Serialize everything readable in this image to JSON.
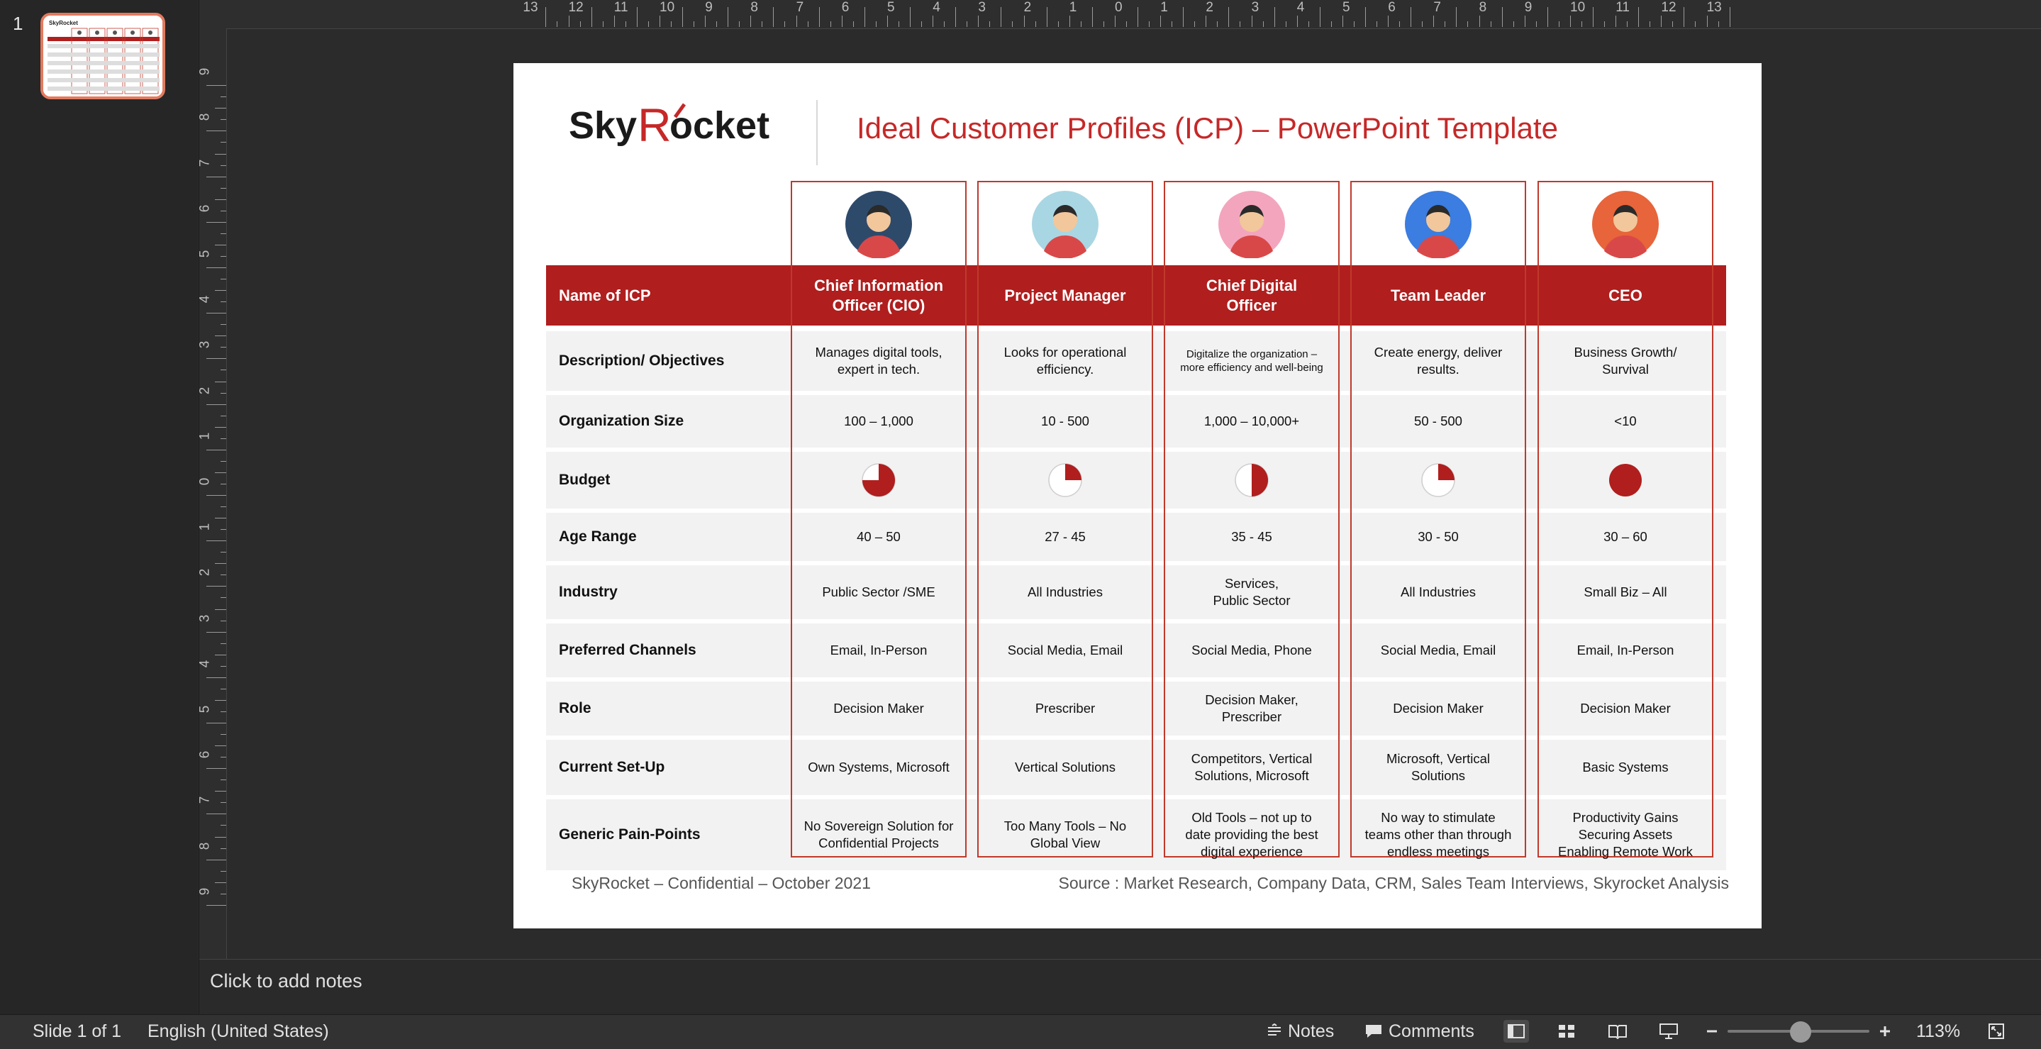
{
  "thumbnails": {
    "slide_number": "1"
  },
  "slide": {
    "logo_text": "SkyRocket",
    "title": "Ideal Customer Profiles (ICP) – PowerPoint Template",
    "header_label": "Name of ICP",
    "footer_left": "SkyRocket – Confidential – October 2021",
    "footer_right": "Source : Market Research, Company Data, CRM, Sales Team Interviews, Skyrocket Analysis",
    "row_labels": [
      "Description/ Objectives",
      "Organization Size",
      "Budget",
      "Age Range",
      "Industry",
      "Preferred Channels",
      "Role",
      "Current Set-Up",
      "Generic Pain-Points"
    ],
    "profiles": [
      {
        "name": "Chief Information\nOfficer (CIO)",
        "avatar_color": "#2e4a6b",
        "description": "Manages digital tools,\nexpert in tech.",
        "org_size": "100 – 1,000",
        "budget_fraction": 0.75,
        "age": "40 – 50",
        "industry": "Public Sector /SME",
        "channels": "Email, In-Person",
        "role": "Decision Maker",
        "setup": "Own Systems, Microsoft",
        "pain": "No Sovereign Solution for\nConfidential Projects"
      },
      {
        "name": "Project Manager",
        "avatar_color": "#a9d6e3",
        "description": "Looks for operational\nefficiency.",
        "org_size": "10 - 500",
        "budget_fraction": 0.25,
        "age": "27 - 45",
        "industry": "All Industries",
        "channels": "Social Media, Email",
        "role": "Prescriber",
        "setup": "Vertical Solutions",
        "pain": "Too Many Tools – No\nGlobal View"
      },
      {
        "name": "Chief Digital\nOfficer",
        "avatar_color": "#f3a5bd",
        "description": "Digitalize the organization –\nmore efficiency and well-being",
        "org_size": "1,000 – 10,000+",
        "budget_fraction": 0.5,
        "age": "35 - 45",
        "industry": "Services,\nPublic Sector",
        "channels": "Social Media, Phone",
        "role": "Decision Maker,\nPrescriber",
        "setup": "Competitors, Vertical\nSolutions, Microsoft",
        "pain": "Old Tools – not up to\ndate providing the best\ndigital experience"
      },
      {
        "name": "Team Leader",
        "avatar_color": "#3b7de0",
        "description": "Create energy, deliver\nresults.",
        "org_size": "50 - 500",
        "budget_fraction": 0.25,
        "age": "30 - 50",
        "industry": "All Industries",
        "channels": "Social Media, Email",
        "role": "Decision Maker",
        "setup": "Microsoft, Vertical\nSolutions",
        "pain": "No way to stimulate\nteams other than through\nendless meetings"
      },
      {
        "name": "CEO",
        "avatar_color": "#e8643a",
        "description": "Business Growth/\nSurvival",
        "org_size": "<10",
        "budget_fraction": 1.0,
        "age": "30 – 60",
        "industry": "Small Biz – All",
        "channels": "Email, In-Person",
        "role": "Decision Maker",
        "setup": "Basic Systems",
        "pain": "Productivity Gains\nSecuring Assets\nEnabling Remote Work"
      }
    ]
  },
  "colors": {
    "accent": "#b01e1e",
    "title_red": "#c62828",
    "row_gray": "#f2f2f2",
    "thumb_border": "#e27a5f"
  },
  "notes": {
    "placeholder": "Click to add notes"
  },
  "status": {
    "slide_info": "Slide 1 of 1",
    "language": "English (United States)",
    "notes_label": "Notes",
    "comments_label": "Comments",
    "zoom": "113%"
  }
}
